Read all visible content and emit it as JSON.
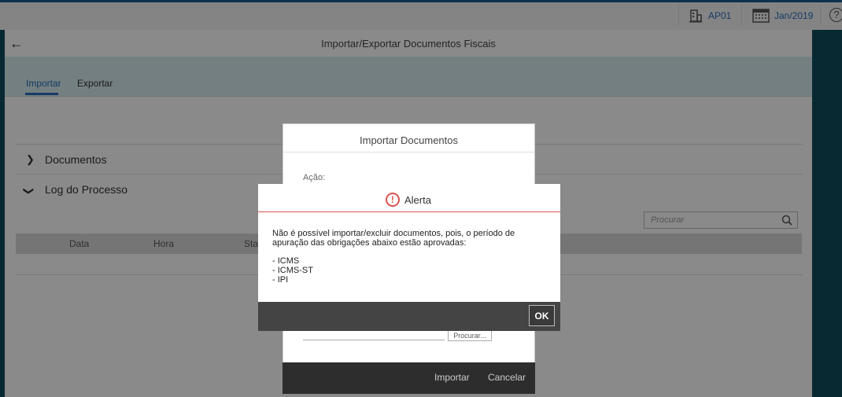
{
  "topbar": {
    "company": "AP01",
    "period": "Jan/2019"
  },
  "header": {
    "title": "Importar/Exportar Documentos Fiscais"
  },
  "tabs": [
    {
      "label": "Importar"
    },
    {
      "label": "Exportar"
    }
  ],
  "sections": {
    "documentos": "Documentos",
    "log": "Log do Processo"
  },
  "search": {
    "placeholder": "Procurar"
  },
  "table": {
    "columns": [
      "Data",
      "Hora",
      "Stat"
    ]
  },
  "import_dialog": {
    "title": "Importar Documentos",
    "acao_label": "Ação:",
    "browse_label": "Procurar...",
    "importar": "Importar",
    "cancelar": "Cancelar"
  },
  "alert": {
    "title": "Alerta",
    "message_line1": "Não é possível importar/excluir documentos, pois, o período de",
    "message_line2": "apuração das obrigações abaixo estão aprovadas:",
    "items": [
      "- ICMS",
      "- ICMS-ST",
      "- IPI"
    ],
    "ok": "OK"
  }
}
